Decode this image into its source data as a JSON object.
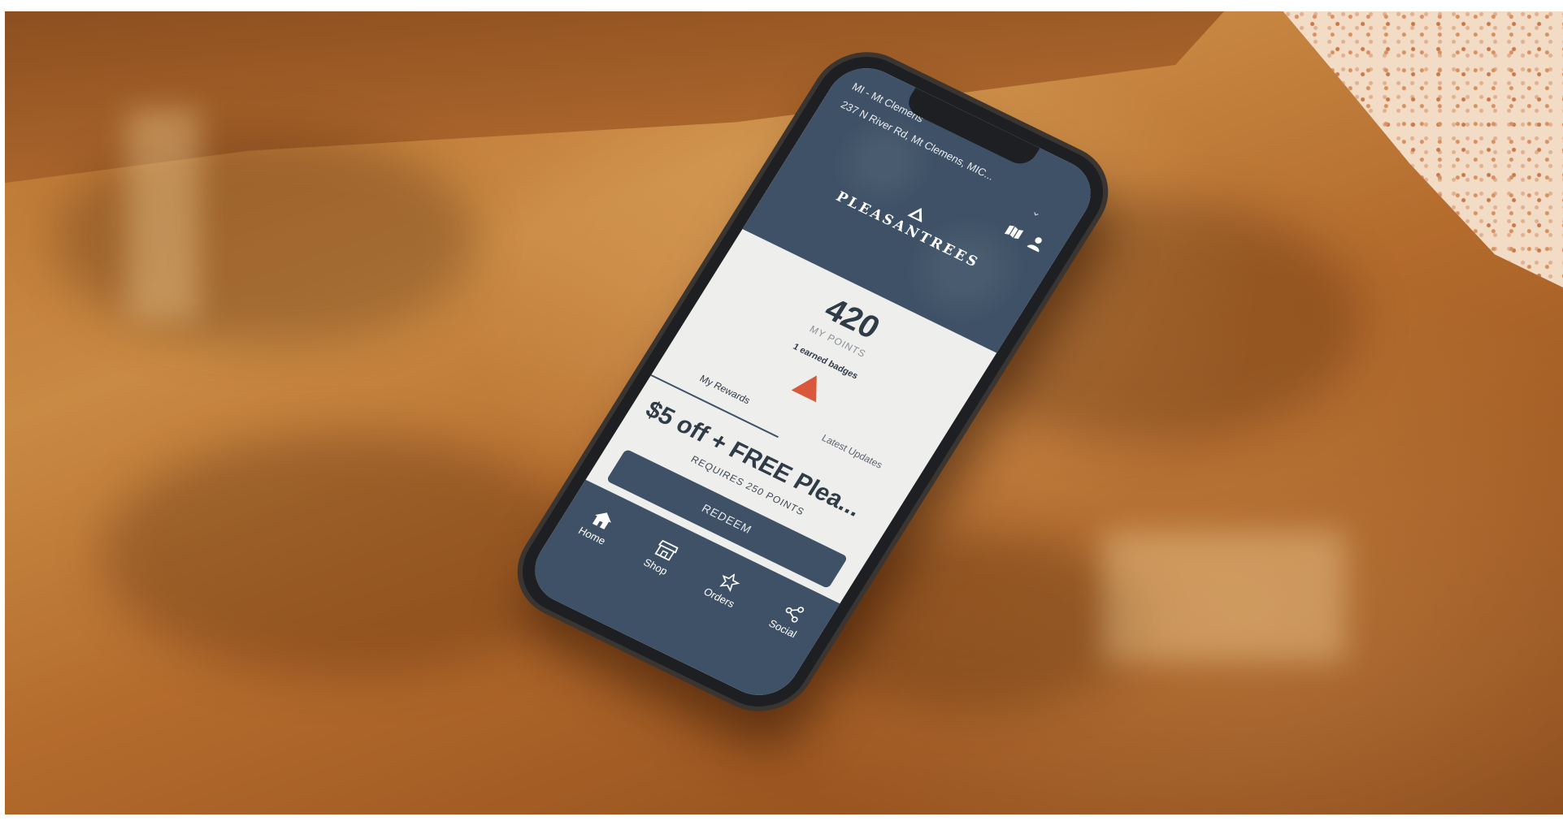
{
  "app": {
    "store_name": "MI - Mt Clemens",
    "store_address": "237 N River Rd, Mt Clemens, MIC...",
    "brand": "PLEASANTREES",
    "colors": {
      "header": "#3e5166",
      "accent": "#d9573a",
      "screen": "#eeeeec"
    }
  },
  "loyalty": {
    "points": "420",
    "points_label": "MY POINTS",
    "badges": "1 earned badges"
  },
  "tabs": [
    {
      "label": "My Rewards",
      "active": true
    },
    {
      "label": "Latest Updates",
      "active": false
    }
  ],
  "reward": {
    "title": "$5 off + FREE Plea...",
    "requirement": "REQUIRES 250 POINTS",
    "redeem_label": "REDEEM"
  },
  "nav": [
    {
      "label": "Home",
      "icon": "home-icon"
    },
    {
      "label": "Shop",
      "icon": "store-icon"
    },
    {
      "label": "Orders",
      "icon": "star-icon"
    },
    {
      "label": "Social",
      "icon": "share-icon"
    }
  ],
  "header_icons": [
    "chevron-down-icon",
    "map-icon",
    "user-icon"
  ]
}
